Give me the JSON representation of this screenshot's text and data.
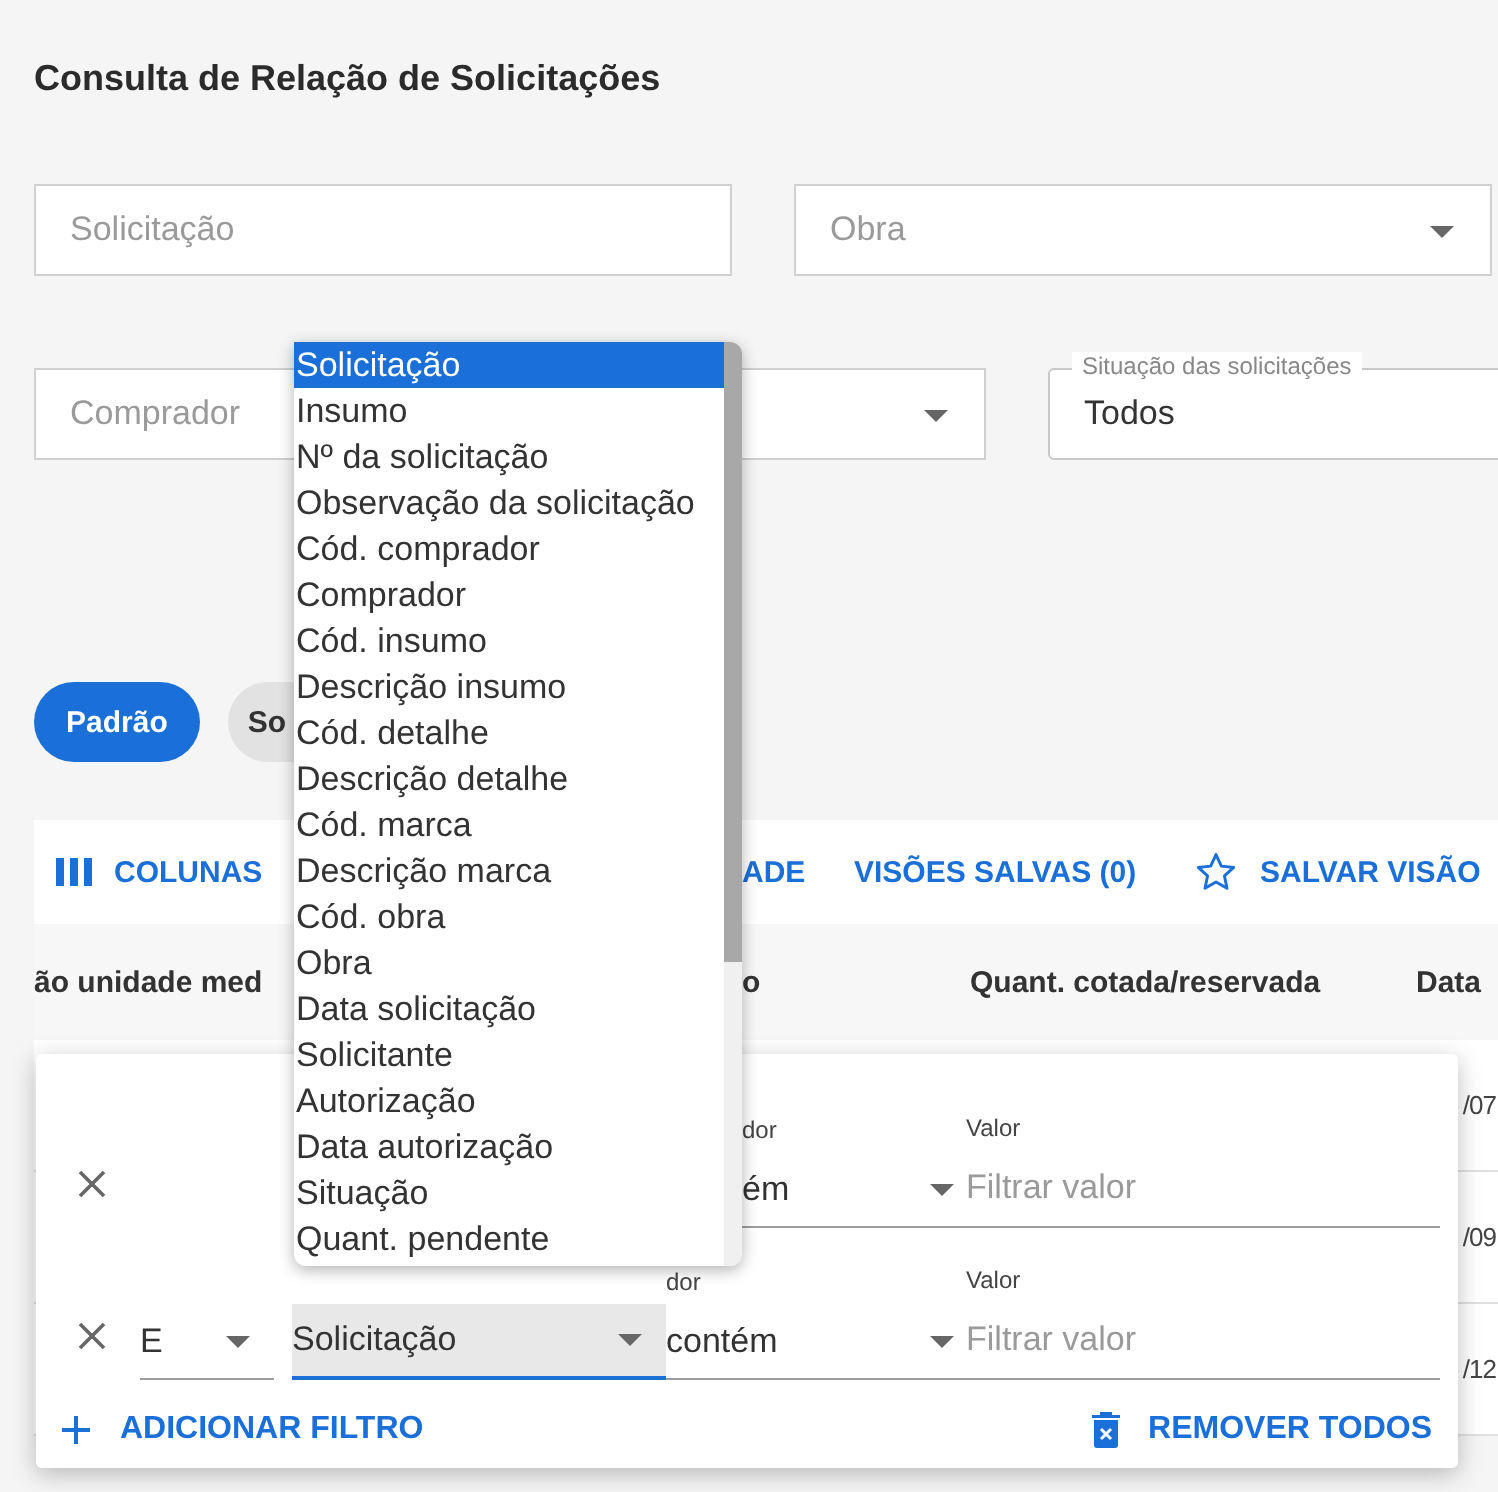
{
  "page_title": "Consulta de Relação de Solicitações",
  "fields": [
    {
      "kind": "text",
      "placeholder": "Solicitação"
    },
    {
      "kind": "select",
      "placeholder": "Obra"
    },
    {
      "kind": "select",
      "placeholder": "Comprador"
    },
    {
      "kind": "outlined",
      "label": "Situação das solicitações",
      "value": "Todos"
    }
  ],
  "views": [
    {
      "label": "Padrão",
      "selected": true
    },
    {
      "label": "So",
      "selected": false
    }
  ],
  "toolbar": [
    {
      "kind": "columns",
      "label": "COLUNAS"
    },
    {
      "kind": "plain",
      "label": "ADE"
    },
    {
      "kind": "plain",
      "label": "VISÕES SALVAS (0)"
    },
    {
      "kind": "star",
      "label": "SALVAR VISÃO"
    }
  ],
  "table": {
    "columns": [
      "ão unidade med",
      "o",
      "Quant. cotada/reservada",
      "Data"
    ],
    "rows": [
      "/07",
      "/09",
      "/12"
    ]
  },
  "filter_panel": {
    "rows": [
      {
        "operator_label": "dor",
        "operator": "ém",
        "value_label": "Valor",
        "value_placeholder": "Filtrar valor"
      },
      {
        "connector": "E",
        "column": {
          "value": "Solicitação",
          "focused": true
        },
        "operator_label": "dor",
        "operator": "contém",
        "value_label": "Valor",
        "value_placeholder": "Filtrar valor"
      }
    ],
    "actions": [
      {
        "kind": "add",
        "label": "ADICIONAR FILTRO"
      },
      {
        "kind": "remove",
        "label": "REMOVER TODOS"
      }
    ]
  },
  "dropdown": {
    "options": [
      {
        "label": "Solicitação",
        "selected": true
      },
      {
        "label": "Insumo",
        "selected": false
      },
      {
        "label": "Nº da solicitação",
        "selected": false
      },
      {
        "label": "Observação da solicitação",
        "selected": false
      },
      {
        "label": "Cód. comprador",
        "selected": false
      },
      {
        "label": "Comprador",
        "selected": false
      },
      {
        "label": "Cód. insumo",
        "selected": false
      },
      {
        "label": "Descrição insumo",
        "selected": false
      },
      {
        "label": "Cód. detalhe",
        "selected": false
      },
      {
        "label": "Descrição detalhe",
        "selected": false
      },
      {
        "label": "Cód. marca",
        "selected": false
      },
      {
        "label": "Descrição marca",
        "selected": false
      },
      {
        "label": "Cód. obra",
        "selected": false
      },
      {
        "label": "Obra",
        "selected": false
      },
      {
        "label": "Data solicitação",
        "selected": false
      },
      {
        "label": "Solicitante",
        "selected": false
      },
      {
        "label": "Autorização",
        "selected": false
      },
      {
        "label": "Data autorização",
        "selected": false
      },
      {
        "label": "Situação",
        "selected": false
      },
      {
        "label": "Quant. pendente",
        "selected": false
      }
    ]
  }
}
